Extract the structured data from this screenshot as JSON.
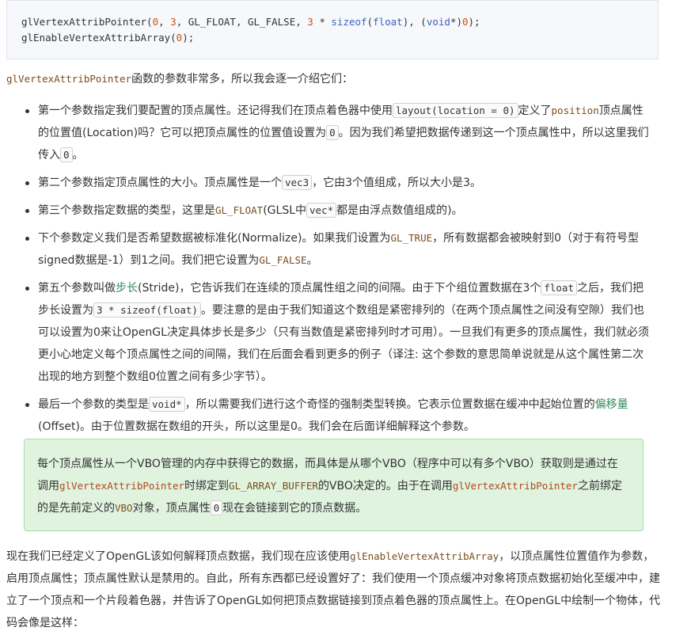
{
  "code": {
    "line1": {
      "fn": "glVertexAttribPointer(",
      "a0": "0",
      "c1": ", ",
      "a1": "3",
      "c2": ", GL_FLOAT, GL_FALSE, ",
      "a2": "3",
      "c3": " * ",
      "kw1": "sizeof",
      "c4": "(",
      "kw2": "float",
      "c5": "), (",
      "kw3": "void",
      "c6": "*)",
      "a3": "0",
      "c7": ");"
    },
    "line2": {
      "fn": "glEnableVertexAttribArray(",
      "a0": "0",
      "c1": ");"
    }
  },
  "intro": {
    "fn": "glVertexAttribPointer",
    "text": "函数的参数非常多，所以我会逐一介绍它们："
  },
  "items": [
    {
      "t1": "第一个参数指定我们要配置的顶点属性。还记得我们在顶点着色器中使用",
      "c1": "layout(location = 0)",
      "t2": "定义了",
      "c2": "position",
      "t3": "顶点属性的位置值(Location)吗？它可以把顶点属性的位置值设置为",
      "c3": "0",
      "t4": "。因为我们希望把数据传递到这一个顶点属性中，所以这里我们传入",
      "c4": "0",
      "t5": "。"
    },
    {
      "t1": "第二个参数指定顶点属性的大小。顶点属性是一个",
      "c1": "vec3",
      "t2": "，它由3个值组成，所以大小是3。"
    },
    {
      "t1": "第三个参数指定数据的类型，这里是",
      "c1": "GL_FLOAT",
      "t2": "(GLSL中",
      "c2": "vec*",
      "t3": "都是由浮点数值组成的)。"
    },
    {
      "t1": "下个参数定义我们是否希望数据被标准化(Normalize)。如果我们设置为",
      "c1": "GL_TRUE",
      "t2": "，所有数据都会被映射到0（对于有符号型signed数据是-1）到1之间。我们把它设置为",
      "c2": "GL_FALSE",
      "t3": "。"
    },
    {
      "t1": "第五个参数叫做",
      "term": "步长",
      "t2": "(Stride)，它告诉我们在连续的顶点属性组之间的间隔。由于下个组位置数据在3个",
      "c1": "float",
      "t3": "之后，我们把步长设置为",
      "c2": "3 * sizeof(float)",
      "t4": "。要注意的是由于我们知道这个数组是紧密排列的（在两个顶点属性之间没有空隙）我们也可以设置为0来让OpenGL决定具体步长是多少（只有当数值是紧密排列时才可用）。一旦我们有更多的顶点属性，我们就必须更小心地定义每个顶点属性之间的间隔，我们在后面会看到更多的例子（译注: 这个参数的意思简单说就是从这个属性第二次出现的地方到整个数组0位置之间有多少字节）。"
    },
    {
      "t1": "最后一个参数的类型是",
      "c1": "void*",
      "t2": "，所以需要我们进行这个奇怪的强制类型转换。它表示位置数据在缓冲中起始位置的",
      "term": "偏移量",
      "t3": "(Offset)。由于位置数据在数组的开头，所以这里是0。我们会在后面详细解释这个参数。"
    }
  ],
  "note": {
    "t1": "每个顶点属性从一个VBO管理的内存中获得它的数据，而具体是从哪个VBO（程序中可以有多个VBO）获取则是通过在调用",
    "fn1": "glVertexAttribPointer",
    "t2": "时绑定到",
    "const1": "GL_ARRAY_BUFFER",
    "t3": "的VBO决定的。由于在调用",
    "fn2": "glVertexAttribPointer",
    "t4": "之前绑定的是先前定义的",
    "const2": "VBO",
    "t5": "对象，顶点属性",
    "c1": "0",
    "t6": "现在会链接到它的顶点数据。"
  },
  "outro": {
    "t1": "现在我们已经定义了OpenGL该如何解释顶点数据，我们现在应该使用",
    "fn": "glEnableVertexAttribArray",
    "t2": "，以顶点属性位置值作为参数，启用顶点属性；顶点属性默认是禁用的。自此，所有东西都已经设置好了：我们使用一个顶点缓冲对象将顶点数据初始化至缓冲中，建立了一个顶点和一个片段着色器，并告诉了OpenGL如何把顶点数据链接到顶点着色器的顶点属性上。在OpenGL中绘制一个物体，代码会像是这样："
  }
}
